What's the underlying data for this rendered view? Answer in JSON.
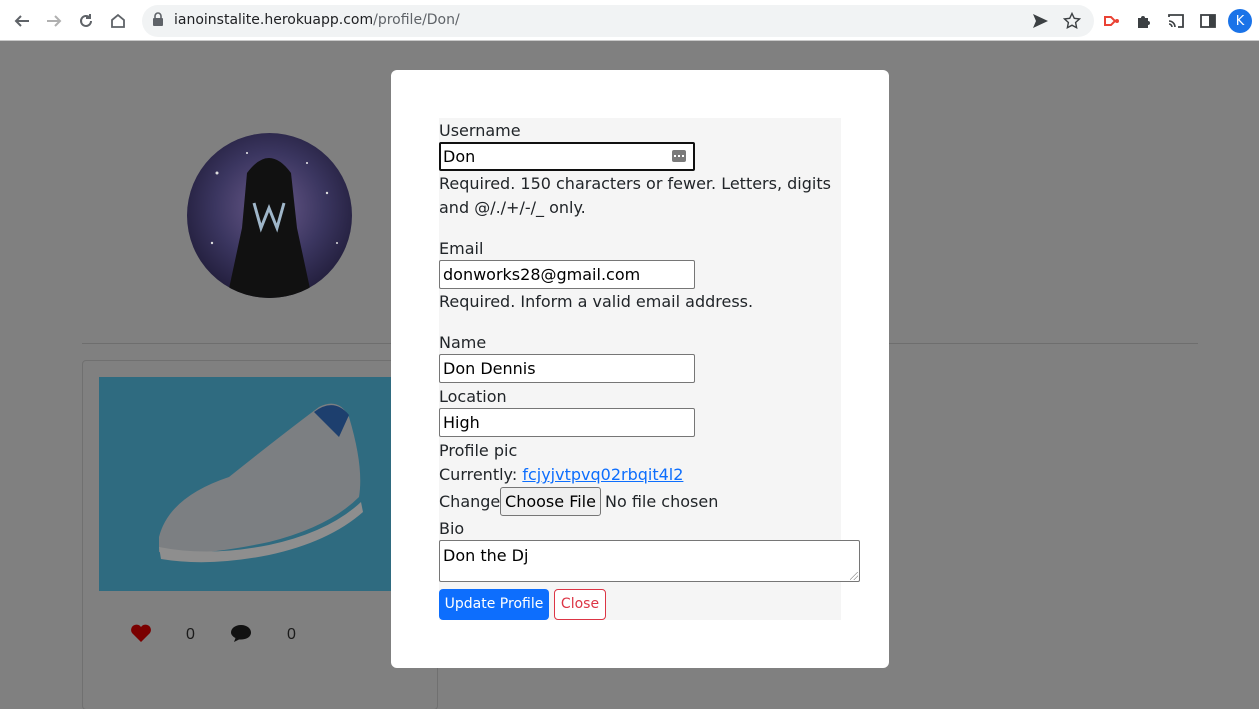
{
  "browser": {
    "url_host": "ianoinstalite.herokuapp.com",
    "url_path": "/profile/Don/",
    "profile_initial": "K"
  },
  "profile": {
    "likes_count": "0",
    "comments_count": "0"
  },
  "form": {
    "username_label": "Username",
    "username_value": "Don",
    "username_help": "Required. 150 characters or fewer. Letters, digits and @/./+/-/_ only.",
    "email_label": "Email",
    "email_value": "donworks28@gmail.com",
    "email_help": "Required. Inform a valid email address.",
    "name_label": "Name",
    "name_value": "Don Dennis",
    "location_label": "Location",
    "location_value": "High",
    "profile_pic_label": "Profile pic",
    "currently_label": "Currently:",
    "current_file": "fcjyjvtpvq02rbqit4l2",
    "change_label": "Change:",
    "choose_file_label": "Choose File",
    "no_file_text": "No file chosen",
    "bio_label": "Bio",
    "bio_value": "Don the Dj",
    "update_button": "Update Profile",
    "close_button": "Close"
  },
  "colors": {
    "primary": "#0d6efd",
    "danger": "#dc3545",
    "backdrop": "#808080"
  }
}
